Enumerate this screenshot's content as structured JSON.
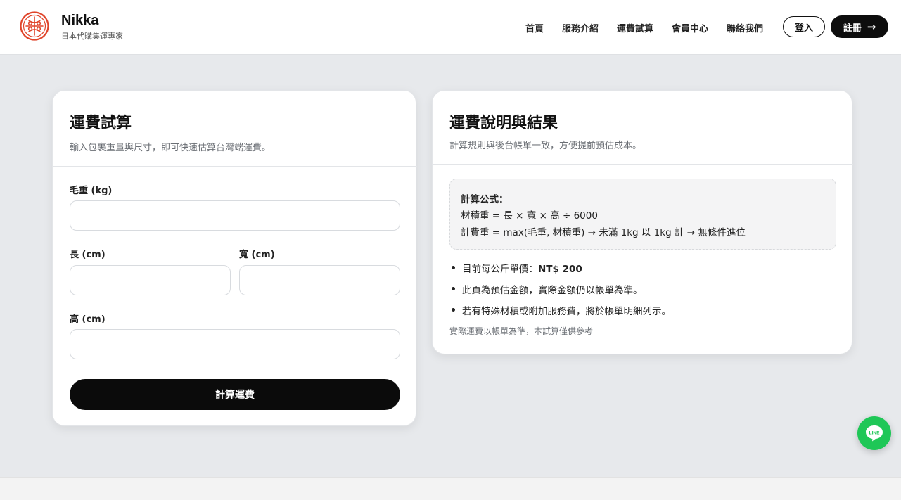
{
  "header": {
    "brand_name": "Nikka",
    "brand_tagline": "日本代購集運專家",
    "nav": [
      "首頁",
      "服務介紹",
      "運費試算",
      "會員中心",
      "聯絡我們"
    ],
    "login_label": "登入",
    "register_label": "註冊",
    "register_icon": "arrow-right-icon"
  },
  "calculator": {
    "title": "運費試算",
    "subtitle": "輸入包裹重量與尺寸，即可快速估算台灣端運費。",
    "weight_label": "毛重 (kg)",
    "length_label": "長 (cm)",
    "width_label": "寬 (cm)",
    "height_label": "高 (cm)",
    "weight_value": "",
    "length_value": "",
    "width_value": "",
    "height_value": "",
    "calc_button": "計算運費"
  },
  "info": {
    "title": "運費說明與結果",
    "subtitle": "計算規則與後台帳單一致，方便提前預估成本。",
    "formula_title": "計算公式：",
    "formula_line1": "材積重 = 長 × 寬 × 高 ÷ 6000",
    "formula_line2": "計費重 = max(毛重, 材積重) → 未滿 1kg 以 1kg 計 → 無條件進位",
    "bullet1_prefix": "目前每公斤單價：",
    "bullet1_value": "NT$ 200",
    "bullet2": "此頁為預估金額，實際金額仍以帳單為準。",
    "bullet3": "若有特殊材積或附加服務費，將於帳單明細列示。",
    "note": "實際運費以帳單為準，本試算僅供參考"
  },
  "floating": {
    "line_icon": "line-chat-icon",
    "line_label": "LINE"
  },
  "colors": {
    "accent": "#0b0b0b",
    "logo_red": "#e0452b",
    "line_green": "#1fc757",
    "background": "#e7e9ec"
  }
}
